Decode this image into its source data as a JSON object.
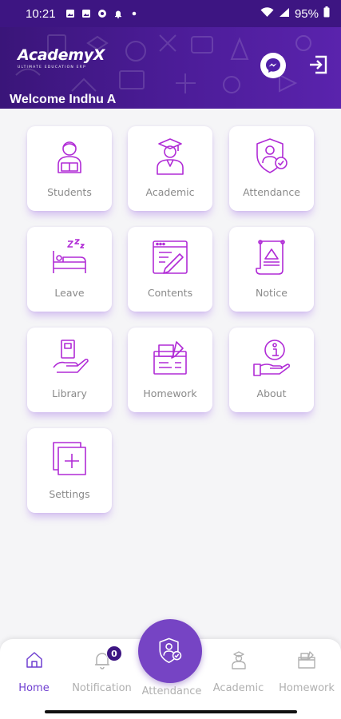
{
  "status_bar": {
    "time": "10:21",
    "battery": "95%",
    "icons": [
      "gallery-icon",
      "gallery-icon",
      "chrome-icon",
      "notification-icon",
      "dot-icon"
    ]
  },
  "header": {
    "brand_name": "AcademyX",
    "brand_tagline": "ULTIMATE EDUCATION ERP",
    "welcome": "Welcome Indhu A",
    "accent_color": "#3d1582"
  },
  "tiles": [
    {
      "label": "Students",
      "icon": "student-icon"
    },
    {
      "label": "Academic",
      "icon": "graduate-icon"
    },
    {
      "label": "Attendance",
      "icon": "attendance-icon"
    },
    {
      "label": "Leave",
      "icon": "sleep-icon"
    },
    {
      "label": "Contents",
      "icon": "contents-icon"
    },
    {
      "label": "Notice",
      "icon": "notice-icon"
    },
    {
      "label": "Library",
      "icon": "library-icon"
    },
    {
      "label": "Homework",
      "icon": "homework-icon"
    },
    {
      "label": "About",
      "icon": "about-icon"
    },
    {
      "label": "Settings",
      "icon": "settings-icon"
    }
  ],
  "bottom_nav": {
    "items": [
      {
        "label": "Home",
        "icon": "home-icon",
        "active": true
      },
      {
        "label": "Notification",
        "icon": "bell-icon",
        "badge": "0"
      },
      {
        "label": "Attendance",
        "icon": "attendance-icon",
        "center": true
      },
      {
        "label": "Academic",
        "icon": "graduate-icon"
      },
      {
        "label": "Homework",
        "icon": "homework-icon"
      }
    ],
    "active_color": "#6f3fd0",
    "fab_color": "#7644c4"
  }
}
